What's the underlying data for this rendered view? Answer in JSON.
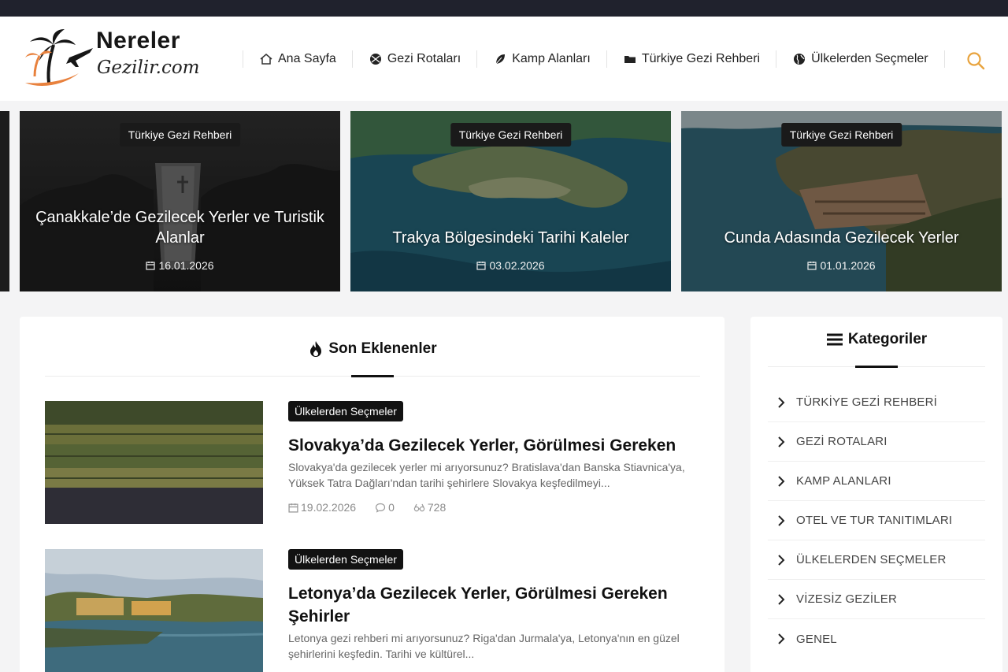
{
  "site": {
    "logo_main": "Nereler",
    "logo_sub": "Gezilir.com"
  },
  "nav": {
    "items": [
      {
        "label": "Ana Sayfa",
        "icon": "home-icon"
      },
      {
        "label": "Gezi Rotaları",
        "icon": "globe-icon"
      },
      {
        "label": "Kamp Alanları",
        "icon": "leaf-icon"
      },
      {
        "label": "Türkiye Gezi Rehberi",
        "icon": "folder-icon"
      },
      {
        "label": "Ülkelerden Seçmeler",
        "icon": "earth-icon"
      }
    ],
    "search_icon": "search-icon",
    "accent_color": "#e8a33d"
  },
  "slider": [
    {
      "category": "Türkiye Gezi Rehberi",
      "title": "Çanakkale’de Gezilecek Yerler ve Turistik Alanlar",
      "date": "16.01.2026"
    },
    {
      "category": "Türkiye Gezi Rehberi",
      "title": "Trakya Bölgesindeki Tarihi Kaleler",
      "date": "03.02.2026"
    },
    {
      "category": "Türkiye Gezi Rehberi",
      "title": "Cunda Adasında Gezilecek Yerler",
      "date": "01.01.2026"
    }
  ],
  "latest": {
    "heading": "Son Eklenenler",
    "posts": [
      {
        "category": "Ülkelerden Seçmeler",
        "title": "Slovakya’da Gezilecek Yerler, Görülmesi Gereken",
        "excerpt": "Slovakya'da gezilecek yerler mi arıyorsunuz? Bratislava'dan Banska Stiavnica'ya, Yüksek Tatra Dağları'ndan tarihi şehirlere Slovakya keşfedilmeyi...",
        "date": "19.02.2026",
        "comments": "0",
        "views": "728"
      },
      {
        "category": "Ülkelerden Seçmeler",
        "title": "Letonya’da Gezilecek Yerler, Görülmesi Gereken Şehirler",
        "excerpt": "Letonya gezi rehberi mi arıyorsunuz? Riga'dan Jurmala'ya, Letonya'nın en güzel şehirlerini keşfedin. Tarihi ve kültürel..."
      }
    ]
  },
  "sidebar": {
    "heading": "Kategoriler",
    "items": [
      "TÜRKİYE GEZİ REHBERİ",
      "GEZİ ROTALARI",
      "KAMP ALANLARI",
      "OTEL VE TUR TANITIMLARI",
      "ÜLKELERDEN SEÇMELER",
      "VİZESİZ GEZİLER",
      "GENEL"
    ]
  }
}
